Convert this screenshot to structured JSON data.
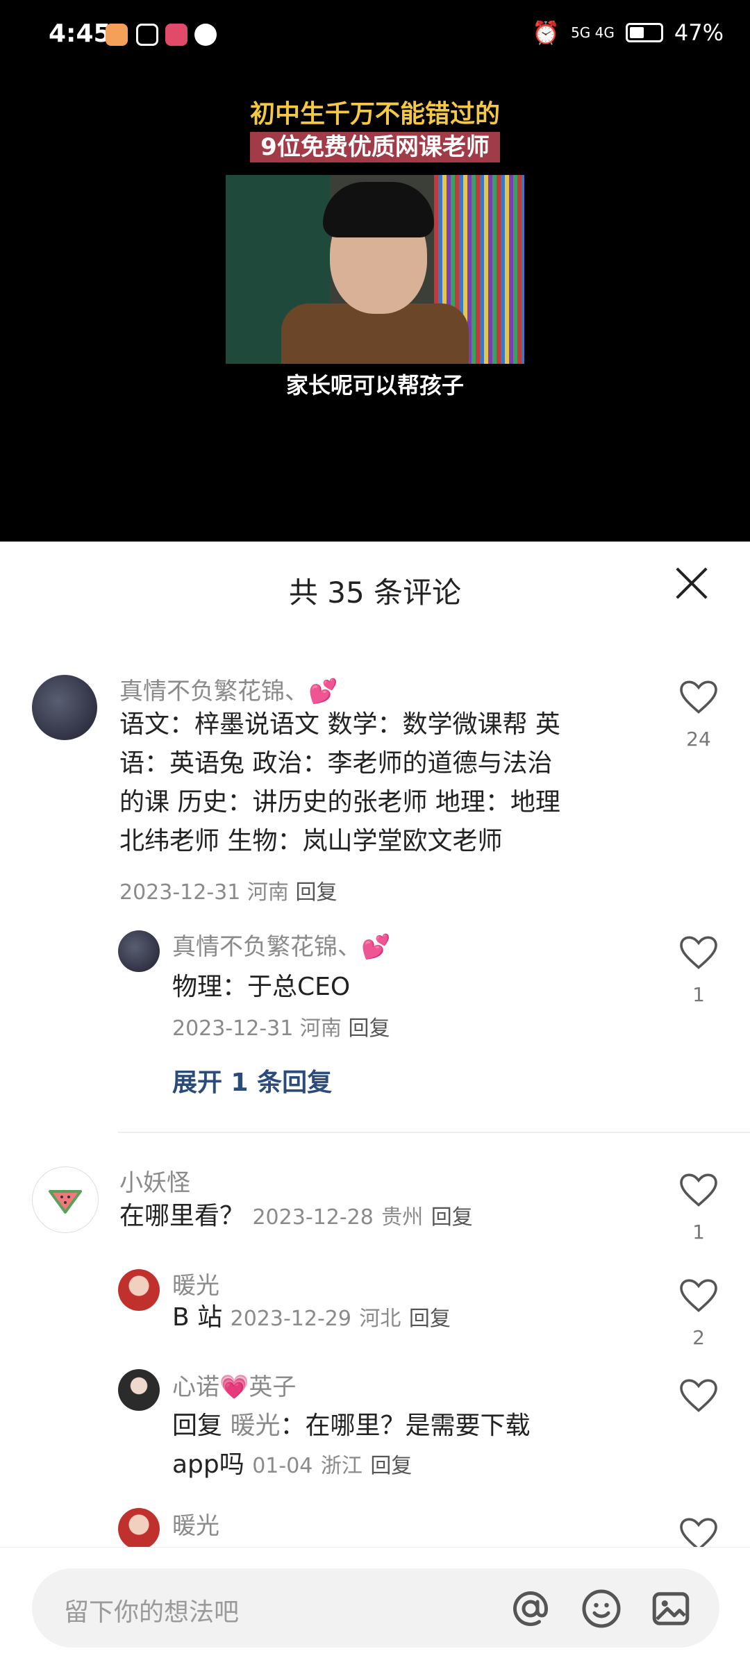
{
  "status_bar": {
    "time": "4:45",
    "network": "5G 4G",
    "battery": "47%",
    "battery_level": 0.47
  },
  "video": {
    "title_line1": "初中生千万不能错过的",
    "title_line2": "9位免费优质网课老师",
    "caption": "家长呢可以帮孩子"
  },
  "comments_panel": {
    "title": "共 35 条评论"
  },
  "comments": [
    {
      "username": "真情不负繁花锦、",
      "emoji": "💕",
      "text_lines": [
        "语文：梓墨说语文 数学：数学微课帮 英",
        "语：英语兔 政治：李老师的道德与法治",
        "的课 历史：讲历史的张老师 地理：地理",
        "北纬老师 生物：岚山学堂欧文老师"
      ],
      "date": "2023-12-31",
      "location": "河南",
      "reply_label": "回复",
      "likes": "24"
    },
    {
      "username": "真情不负繁花锦、",
      "emoji": "💕",
      "text": "物理：于总CEO",
      "date": "2023-12-31",
      "location": "河南",
      "reply_label": "回复",
      "likes": "1"
    },
    {
      "username": "小妖怪",
      "text": "在哪里看？",
      "date": "2023-12-28",
      "location": "贵州",
      "reply_label": "回复",
      "likes": "1"
    },
    {
      "username": "暖光",
      "text": "B 站",
      "date": "2023-12-29",
      "location": "河北",
      "reply_label": "回复",
      "likes": "2"
    },
    {
      "username_a": "心诺",
      "username_emoji": "💗",
      "username_b": "英子",
      "reply_prefix": "回复",
      "reply_to": "暖光",
      "text_a": "：在哪里？是需要下载",
      "text_b": "app吗",
      "date": "01-04",
      "location": "浙江",
      "reply_label": "回复"
    },
    {
      "username": "暖光"
    }
  ],
  "expand_replies": "展开 1 条回复",
  "input": {
    "placeholder": "留下你的想法吧"
  }
}
